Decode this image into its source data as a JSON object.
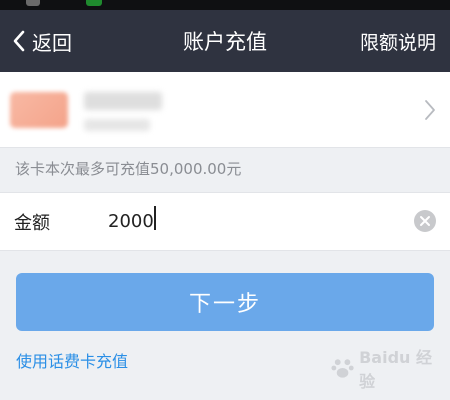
{
  "navbar": {
    "back_label": "返回",
    "title": "账户充值",
    "right_label": "限额说明"
  },
  "card": {
    "bank_logo": "bank-logo",
    "details_blurred": true
  },
  "limit_notice": "该卡本次最多可充值50,000.00元",
  "amount": {
    "label": "金额",
    "value": "2000"
  },
  "next_button_label": "下一步",
  "phone_card_link": "使用话费卡充值",
  "watermark": "Baidu 经验",
  "colors": {
    "navbar": "#2f3340",
    "button": "#6aa8ea",
    "link": "#2b8fe6",
    "background": "#eef0f3"
  }
}
